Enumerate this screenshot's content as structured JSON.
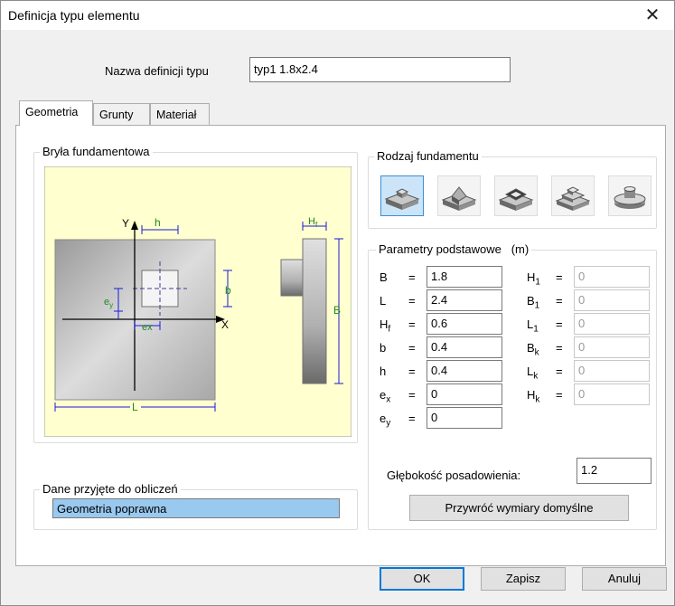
{
  "window": {
    "title": "Definicja typu elementu"
  },
  "type_name": {
    "label": "Nazwa definicji typu",
    "value": "typ1 1.8x2.4"
  },
  "tabs": [
    "Geometria",
    "Grunty",
    "Materiał"
  ],
  "solid_group": {
    "title": "Bryła fundamentowa",
    "drawing": {
      "h": "h",
      "b": "b",
      "L": "L",
      "B": "B",
      "Hf": "H",
      "Hf_sub": "f",
      "Y": "Y",
      "X": "X",
      "ex": "ex",
      "ey": "e",
      "ey_sub": "y"
    }
  },
  "type_group": {
    "title": "Rodzaj fundamentu",
    "types": [
      {
        "name": "stopa prostopadłościenna",
        "selected": true
      },
      {
        "name": "stopa schodkowa skośna",
        "selected": false
      },
      {
        "name": "stopa kielichowa",
        "selected": false
      },
      {
        "name": "stopa schodkowa",
        "selected": false
      },
      {
        "name": "stopa okrągła",
        "selected": false
      }
    ]
  },
  "params": {
    "title": "Parametry podstawowe",
    "unit": "(m)",
    "left": [
      {
        "sym": "B",
        "sub": "",
        "value": "1.8"
      },
      {
        "sym": "L",
        "sub": "",
        "value": "2.4"
      },
      {
        "sym": "H",
        "sub": "f",
        "value": "0.6"
      },
      {
        "sym": "b",
        "sub": "",
        "value": "0.4"
      },
      {
        "sym": "h",
        "sub": "",
        "value": "0.4"
      },
      {
        "sym": "e",
        "sub": "x",
        "value": "0"
      },
      {
        "sym": "e",
        "sub": "y",
        "value": "0"
      }
    ],
    "right": [
      {
        "sym": "H",
        "sub": "1",
        "value": "0"
      },
      {
        "sym": "B",
        "sub": "1",
        "value": "0"
      },
      {
        "sym": "L",
        "sub": "1",
        "value": "0"
      },
      {
        "sym": "B",
        "sub": "k",
        "value": "0"
      },
      {
        "sym": "L",
        "sub": "k",
        "value": "0"
      },
      {
        "sym": "H",
        "sub": "k",
        "value": "0"
      }
    ],
    "eq": "="
  },
  "depth": {
    "label": "Głębokość posadowienia:",
    "value": "1.2"
  },
  "restore_button": "Przywróć wymiary domyślne",
  "calc_group": {
    "title": "Dane przyjęte do obliczeń",
    "status": "Geometria poprawna"
  },
  "buttons": {
    "ok": "OK",
    "save": "Zapisz",
    "cancel": "Anuluj"
  },
  "colors": {
    "drawing_bg": "#ffffd0",
    "accent": "#0078d7",
    "status_bg": "#99c9ef",
    "dim_blue": "#1a1ad6",
    "dim_green": "#1f8a1f"
  }
}
